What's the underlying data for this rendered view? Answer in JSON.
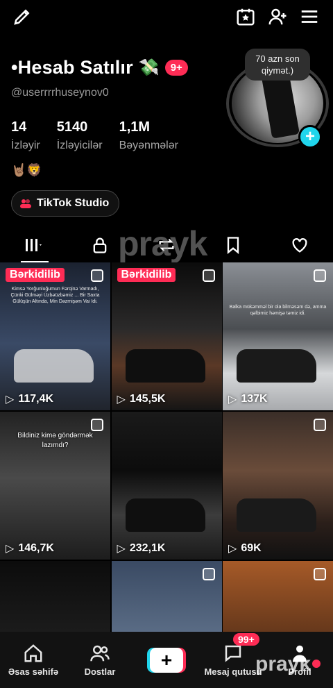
{
  "profile": {
    "name": "•Hesab Satılır",
    "name_emoji": "💸",
    "notification_badge": "9+",
    "username": "@userrrrhuseynov0",
    "note_bubble": "70 azn son qiymət.)",
    "emojis": "🤘🏽🦁",
    "stats": [
      {
        "value": "14",
        "label": "İzləyir"
      },
      {
        "value": "5140",
        "label": "İzləyicilər"
      },
      {
        "value": "1,1M",
        "label": "Bəyənmələr"
      }
    ],
    "studio_button": "TikTok Studio"
  },
  "tabs": [
    {
      "icon": "grid-icon",
      "active": true
    },
    {
      "icon": "lock-icon",
      "active": false
    },
    {
      "icon": "repost-icon",
      "active": false
    },
    {
      "icon": "bookmark-icon",
      "active": false
    },
    {
      "icon": "heart-icon",
      "active": false
    }
  ],
  "watermark": "prayk",
  "videos": [
    {
      "pinned": "Bərkidilib",
      "views": "117,4K",
      "caption": "Kimsə Yorğunluğumun Fərqinə Varmadı, Çünki Gülməyi Üzbəüzbəmiz ... Bir Saxta Gülüşün Altında, Min Dəzmişəm Vai Idi.",
      "multi": true
    },
    {
      "pinned": "Bərkidilib",
      "views": "145,5K",
      "caption": "",
      "multi": true
    },
    {
      "pinned": "",
      "views": "137K",
      "caption": "Balka mükəmməl bir ola bilməsəm də, amma qəlbimiz həmişə təmiz idi.",
      "multi": true
    },
    {
      "pinned": "",
      "views": "146,7K",
      "caption": "Bildiniz kimə göndərmək lazımdı?",
      "multi": true
    },
    {
      "pinned": "",
      "views": "232,1K",
      "caption": "",
      "multi": false
    },
    {
      "pinned": "",
      "views": "69K",
      "caption": "",
      "multi": true
    },
    {
      "pinned": "",
      "views": "",
      "caption": "",
      "multi": false
    },
    {
      "pinned": "",
      "views": "",
      "caption": "",
      "multi": true
    },
    {
      "pinned": "",
      "views": "",
      "caption": "",
      "multi": true
    }
  ],
  "bottom_nav": {
    "home": "Əsas səhifə",
    "friends": "Dostlar",
    "inbox": "Mesaj qutusu",
    "inbox_badge": "99+",
    "profile": "Profil"
  },
  "colors": {
    "accent": "#fe2c55",
    "cyan": "#20d5ec"
  }
}
